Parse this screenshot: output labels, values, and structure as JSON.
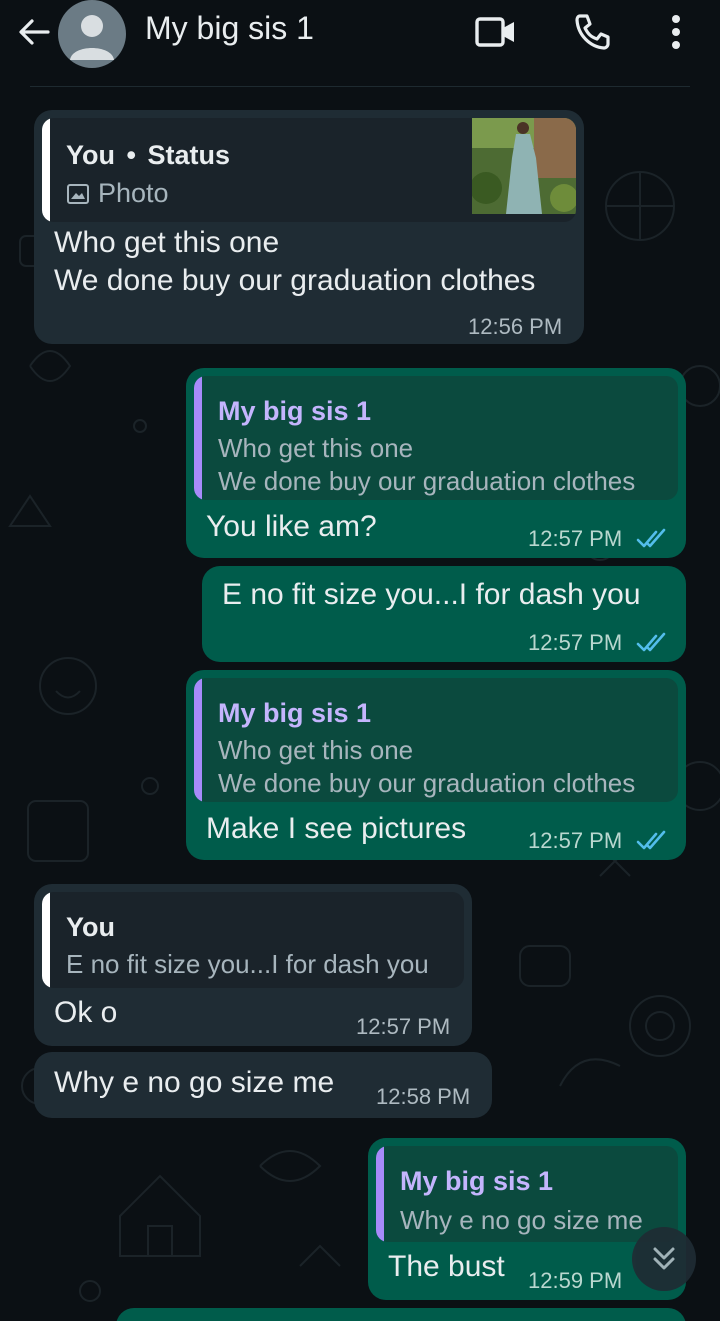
{
  "header": {
    "title": "My big sis 1"
  },
  "messages": {
    "m1": {
      "quote_author": "You",
      "quote_sep": "•",
      "quote_kind": "Status",
      "quote_media": "Photo",
      "text": "Who get this one\nWe done buy our graduation clothes",
      "time": "12:56 PM"
    },
    "m2": {
      "quote_author": "My big sis 1",
      "quote_text": "Who get this one\nWe done buy our graduation clothes",
      "text": "You like am?",
      "time": "12:57 PM"
    },
    "m3": {
      "text": "E no fit size you...I for dash you",
      "time": "12:57 PM"
    },
    "m4": {
      "quote_author": "My big sis 1",
      "quote_text": "Who get this one\nWe done buy our graduation clothes",
      "text": "Make I see pictures",
      "time": "12:57 PM"
    },
    "m5": {
      "quote_author": "You",
      "quote_text": "E no fit size you...I for dash you",
      "text": "Ok o",
      "time": "12:57 PM"
    },
    "m6": {
      "text": "Why e no go size me",
      "time": "12:58 PM"
    },
    "m7": {
      "quote_author": "My big sis 1",
      "quote_text": "Why e no go size me",
      "text": "The bust",
      "time": "12:59 PM"
    }
  },
  "colors": {
    "incoming_bubble": "#1f2c34",
    "outgoing_bubble": "#005c4b",
    "quote_bar_self": "#ffffff",
    "quote_bar_contact": "#a78bfa",
    "read_ticks": "#53bdeb"
  },
  "icons": [
    "back-arrow-icon",
    "avatar-placeholder",
    "video-call-icon",
    "phone-icon",
    "more-vert-icon",
    "image-icon",
    "double-check-icon",
    "scroll-down-icon"
  ]
}
